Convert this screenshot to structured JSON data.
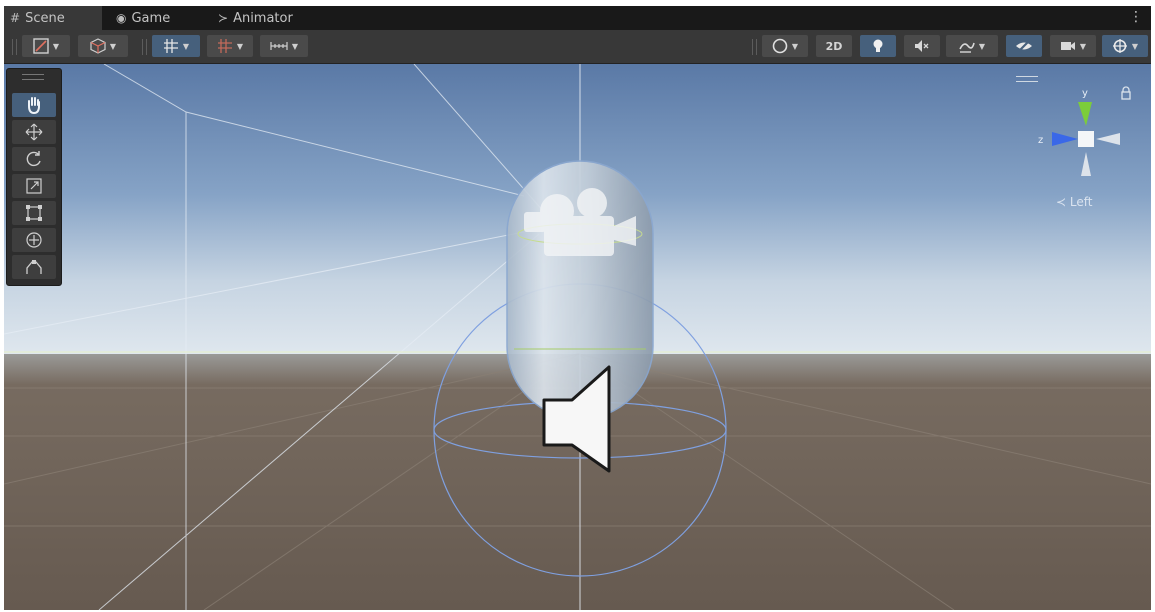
{
  "tabs": [
    {
      "icon": "scene-grid-icon",
      "label": "Scene",
      "active": true
    },
    {
      "icon": "gamepad-icon",
      "label": "Game",
      "active": false
    },
    {
      "icon": "animator-icon",
      "label": "Animator",
      "active": false
    }
  ],
  "tab_glyphs": {
    "scene": "#",
    "game": "◉",
    "animator": "≻"
  },
  "more_menu": "⋮",
  "toolbar": {
    "draw_mode_icon": "shaded-draw-mode-icon",
    "render_paths_icon": "cube-icon",
    "grid_snap_icon": "grid-snap-icon",
    "increment_snap_icon": "increment-snap-icon",
    "ruler_icon": "ruler-icon",
    "globe_icon": "globe-icon",
    "mode_2d_label": "2D",
    "lighting_icon": "lightbulb-icon",
    "audio_icon": "audio-mute-icon",
    "fx_icon": "effects-icon",
    "visibility_icon": "hidden-eye-icon",
    "camera_icon": "camera-icon",
    "gizmos_icon": "gizmos-icon"
  },
  "tools": [
    {
      "name": "view-tool",
      "icon": "hand-icon",
      "selected": true
    },
    {
      "name": "move-tool",
      "icon": "move-arrows-icon",
      "selected": false
    },
    {
      "name": "rotate-tool",
      "icon": "rotate-icon",
      "selected": false
    },
    {
      "name": "scale-tool",
      "icon": "scale-icon",
      "selected": false
    },
    {
      "name": "rect-tool",
      "icon": "rect-transform-icon",
      "selected": false
    },
    {
      "name": "transform-tool",
      "icon": "transform-icon",
      "selected": false
    },
    {
      "name": "custom-tool",
      "icon": "custom-tool-icon",
      "selected": false
    }
  ],
  "gizmo": {
    "view_label": "≺ Left",
    "axis_z_label": "z",
    "axis_y_label": "y"
  },
  "colors": {
    "accent_selected": "#46607c",
    "toolbar_bg": "#383838",
    "tab_bg": "#191919",
    "sky_top": "#5a79a6",
    "sky_horizon": "#d9e2ea",
    "ground": "#6a5e53",
    "gizmo_y": "#7ccd3a",
    "gizmo_z": "#3a68e8"
  }
}
